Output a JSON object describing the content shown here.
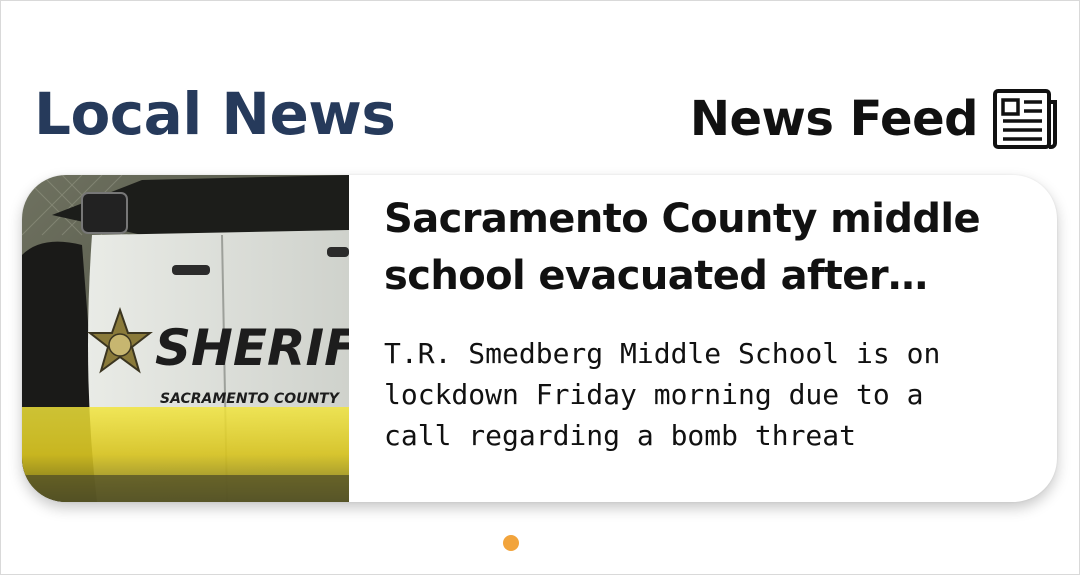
{
  "header": {
    "title": "Local News",
    "feed_label": "News Feed",
    "feed_icon": "newspaper-icon",
    "title_color": "#263a5b"
  },
  "carousel": {
    "items": [
      {
        "headline": "Sacramento County middle school evacuated after bomb threat",
        "summary": "T.R. Smedberg Middle School is on lockdown Friday morning due to a call regarding a bomb threat",
        "image_text": {
          "badge": "SHERIFF",
          "sub_badge": "SACRAMENTO COUNTY"
        }
      }
    ],
    "current_page": 1,
    "total_pages": 1,
    "dot_color": "#f2a43c"
  }
}
